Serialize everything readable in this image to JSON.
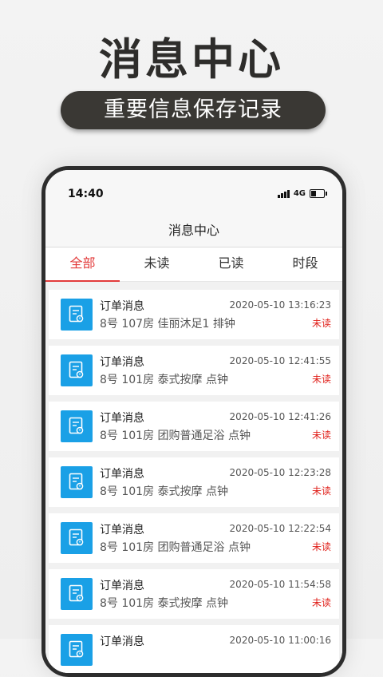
{
  "promo": {
    "title": "消息中心",
    "subtitle": "重要信息保存记录"
  },
  "status_bar": {
    "time": "14:40",
    "network": "4G"
  },
  "header": {
    "title": "消息中心"
  },
  "tabs": [
    {
      "label": "全部",
      "active": true
    },
    {
      "label": "未读",
      "active": false
    },
    {
      "label": "已读",
      "active": false
    },
    {
      "label": "时段",
      "active": false
    }
  ],
  "messages": [
    {
      "title": "订单消息",
      "time": "2020-05-10 13:16:23",
      "body": "8号 107房 佳丽沐足1 排钟",
      "status": "未读"
    },
    {
      "title": "订单消息",
      "time": "2020-05-10 12:41:55",
      "body": "8号 101房 泰式按摩 点钟",
      "status": "未读"
    },
    {
      "title": "订单消息",
      "time": "2020-05-10 12:41:26",
      "body": "8号 101房 团购普通足浴 点钟",
      "status": "未读"
    },
    {
      "title": "订单消息",
      "time": "2020-05-10 12:23:28",
      "body": "8号 101房 泰式按摩 点钟",
      "status": "未读"
    },
    {
      "title": "订单消息",
      "time": "2020-05-10 12:22:54",
      "body": "8号 101房 团购普通足浴 点钟",
      "status": "未读"
    },
    {
      "title": "订单消息",
      "time": "2020-05-10 11:54:58",
      "body": "8号 101房 泰式按摩 点钟",
      "status": "未读"
    },
    {
      "title": "订单消息",
      "time": "2020-05-10 11:00:16",
      "body": "",
      "status": ""
    }
  ],
  "colors": {
    "accent": "#e23b3b",
    "icon_bg": "#1aa0e6",
    "unread": "#e0201a",
    "pill_bg": "#3a3834"
  }
}
